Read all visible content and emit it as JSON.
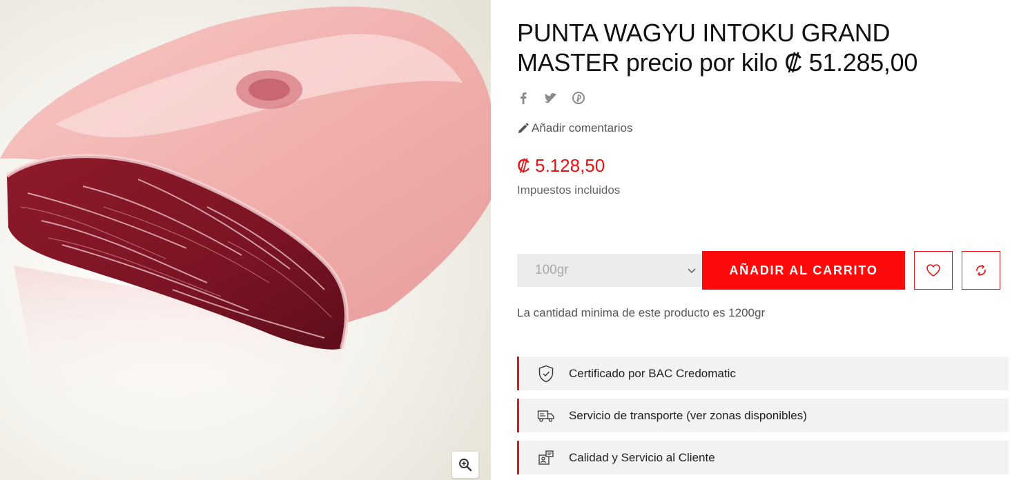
{
  "product": {
    "title_line1": "PUNTA WAGYU INTOKU GRAND",
    "title_line2": "MASTER precio por kilo ₡ 51.285,00",
    "price": "₡ 5.128,50",
    "tax_note": "Impuestos incluidos",
    "review_link": "Añadir comentarios",
    "min_quantity_note": "La cantidad minima de este producto es 1200gr"
  },
  "social": [
    {
      "icon": "facebook-icon",
      "glyph": "f"
    },
    {
      "icon": "twitter-icon",
      "glyph": "t"
    },
    {
      "icon": "pinterest-icon",
      "glyph": "p"
    }
  ],
  "cart": {
    "quantity_selected": "100gr",
    "add_to_cart_label": "AÑADIR AL CARRITO"
  },
  "features": [
    {
      "icon": "shield-check-icon",
      "label": "Certificado por BAC Credomatic"
    },
    {
      "icon": "delivery-truck-icon",
      "label": "Servicio de transporte (ver zonas disponibles)"
    },
    {
      "icon": "customer-service-icon",
      "label": "Calidad y Servicio al Cliente"
    }
  ],
  "colors": {
    "accent": "#ff0a0a",
    "price": "#ee1111",
    "feature_bg": "#f2f2f2",
    "image_bg": "#ebe8df"
  }
}
